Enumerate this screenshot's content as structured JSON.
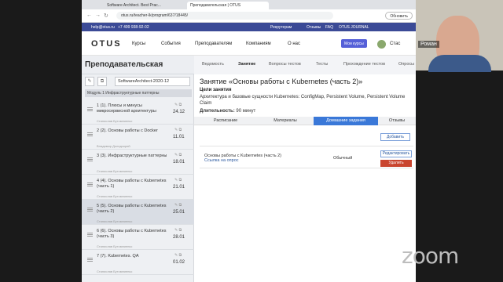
{
  "browser": {
    "tabs": [
      {
        "label": "Software Architect. Best Prac..."
      },
      {
        "label": "Преподавательская | OTUS"
      }
    ],
    "url": "otus.ru/teacher-lk/program/637/18445/",
    "refresh_label": "Обновить"
  },
  "topstrip": {
    "email": "help@otus.ru",
    "phone": "+7 499 938-92-02",
    "links": [
      "Рекрутерам",
      "Отзывы",
      "FAQ",
      "OTUS JOURNAL"
    ]
  },
  "mainnav": {
    "logo": "OTUS",
    "items": [
      "Курсы",
      "События",
      "Преподавателям",
      "Компаниям",
      "О нас"
    ],
    "my_courses": "Мои курсы",
    "user": "Стас"
  },
  "teacher": {
    "title": "Преподавательская",
    "tabs": [
      "Ведомость",
      "Занятие",
      "Вопросы тестов",
      "Тесты",
      "Прохождение тестов",
      "Опросы"
    ]
  },
  "sidebar": {
    "group_select": "SoftwareArchitect-2020-12",
    "module": "Модуль 1 Инфраструктурные паттерны",
    "lessons": [
      {
        "title": "1 (1). Плюсы и минусы микросервисной архитектуры",
        "teacher": "Станислав Бутомниенко",
        "date": "24.12"
      },
      {
        "title": "2 (2). Основы работы с Docker",
        "teacher": "Владимир Долидзорий",
        "date": "11.01"
      },
      {
        "title": "3 (3). Инфраструктурные паттерны",
        "teacher": "Станислав Бутомниенко",
        "date": "18.01"
      },
      {
        "title": "4 (4). Основы работы с Kubernetes (часть 1)",
        "teacher": "Станислав Бутомниенко",
        "date": "21.01"
      },
      {
        "title": "5 (5). Основы работы с Kubernetes (часть 2)",
        "teacher": "Станислав Бутомниенко",
        "date": "25.01"
      },
      {
        "title": "6 (6). Основы работы с Kubernetes (часть 3)",
        "teacher": "Станислав Бутомниенко",
        "date": "28.01"
      },
      {
        "title": "7 (7). Kubernetes. QA",
        "teacher": "Станислав Бутомниенко",
        "date": "01.02"
      }
    ]
  },
  "content": {
    "title": "Занятие «Основы работы с Kubernetes (часть 2)»",
    "goals_label": "Цели занятия",
    "goals_text": "Архитектура и базовые сущности Kubernetes: ConfigMap, Persistent Volume, Persistent Volume Claim",
    "duration_label": "Длительность:",
    "duration_value": "90 минут",
    "tabs": [
      "Расписание",
      "Материалы",
      "Домашние задания",
      "Отзывы"
    ],
    "add_label": "Добавить",
    "homework": {
      "title": "Основы работы с Kubernetes (часть 2)",
      "link": "Ссылка на опрос",
      "type": "Обычный",
      "edit_label": "Редактировать",
      "delete_label": "Удалить"
    }
  },
  "zoom": {
    "participant_name": "Роман",
    "logo": "zoom"
  }
}
